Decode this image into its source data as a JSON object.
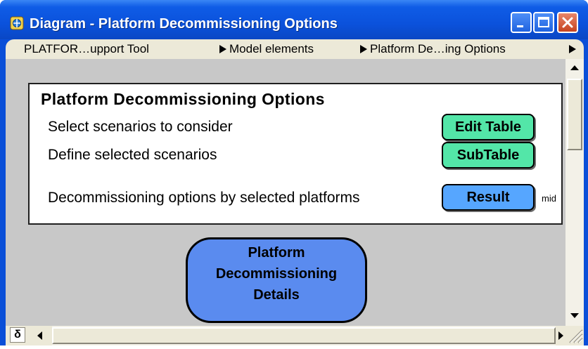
{
  "window": {
    "title": "Diagram - Platform Decommissioning Options",
    "controls": [
      "minimize",
      "maximize",
      "close"
    ]
  },
  "breadcrumb": {
    "items": [
      {
        "label": "PLATFOR…upport Tool",
        "arrow": false
      },
      {
        "label": "Model elements",
        "arrow": true
      },
      {
        "label": "Platform  De…ing Options",
        "arrow": true
      }
    ],
    "more_arrow": "▶"
  },
  "panel": {
    "title": "Platform Decommissioning Options",
    "rows": [
      {
        "label": "Select scenarios to consider",
        "button": "Edit Table"
      },
      {
        "label": "Define selected scenarios",
        "button": "SubTable"
      },
      {
        "label": "Decommissioning options by selected platforms",
        "button": "Result",
        "suffix": "mid"
      }
    ]
  },
  "module": {
    "lines": [
      "Platform",
      "Decommissioning",
      "Details"
    ]
  },
  "statusbar": {
    "left_glyph": "δ"
  },
  "colors": {
    "title_bar": "#0b52dc",
    "canvas": "#c8c8c8",
    "button_green": "#53e6a8",
    "button_blue": "#56a6ff",
    "module_fill": "#5a8bef"
  },
  "icons": {
    "app": "app-icon",
    "minimize": "minimize-icon",
    "maximize": "maximize-icon",
    "close": "close-icon",
    "scroll_up": "arrow-up-icon",
    "scroll_down": "arrow-down-icon",
    "scroll_left": "arrow-left-icon",
    "scroll_right": "arrow-right-icon",
    "resize": "resize-grip-icon"
  }
}
